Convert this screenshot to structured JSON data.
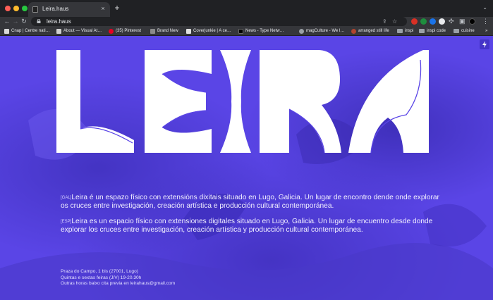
{
  "tab": {
    "title": "Leira.haus",
    "close_glyph": "×",
    "new_tab_glyph": "+"
  },
  "toolbar": {
    "url": "leira.haus"
  },
  "bookmarks": [
    {
      "label": "Cnap | Centre nati…",
      "icon": "cnap-icon",
      "color": "#d9d9d9"
    },
    {
      "label": "About — Visual At…",
      "icon": "page-icon",
      "color": "#d0d0d0"
    },
    {
      "label": "(35) Pinterest",
      "icon": "pinterest-icon",
      "color": "#e60023"
    },
    {
      "label": "Brand New",
      "icon": "brand-new-icon",
      "color": "#8a8a8a"
    },
    {
      "label": "Coverjunkie | A ce…",
      "icon": "page-icon",
      "color": "#e0e0e0"
    },
    {
      "label": "News - Type Netw…",
      "icon": "type-network-icon",
      "color": "#000000"
    },
    {
      "label": "magCulture - We l…",
      "icon": "globe-icon",
      "color": "#9aa0a6"
    },
    {
      "label": "arranged still life",
      "icon": "still-life-icon",
      "color": "#b0452e"
    },
    {
      "label": "inspi",
      "icon": "folder-icon",
      "color": "#9aa0a6"
    },
    {
      "label": "inspi code",
      "icon": "folder-icon",
      "color": "#9aa0a6"
    },
    {
      "label": "cuisine",
      "icon": "folder-icon",
      "color": "#9aa0a6"
    }
  ],
  "bookmarks_overflow": "»",
  "page": {
    "logo_text": "LEIRA",
    "paragraphs": [
      {
        "lang": "[GAL]",
        "text": "Leira é un espazo físico con extensións dixitais situado en Lugo, Galicia. Un lugar de encontro dende onde explorar os cruces entre investigación, creación artística e producción cultural contemporánea."
      },
      {
        "lang": "[ESP]",
        "text": "Leira es un espacio físico con extensiones digitales situado en Lugo, Galicia. Un lugar de encuentro desde donde explorar los cruces entre investigación, creación artística y producción cultural contemporánea."
      }
    ],
    "address": [
      "Praza do Campo, 1 bis  (27001, Lugo)",
      "Quintas e sextas feiras (J/V) 19-20.30h",
      "Outras horas baixo cita previa en leirahaus@gmail.com"
    ]
  },
  "colors": {
    "background": "#5a45e6",
    "logo": "#ffffff",
    "chrome_dark": "#202124",
    "chrome_toolbar": "#35363a"
  }
}
